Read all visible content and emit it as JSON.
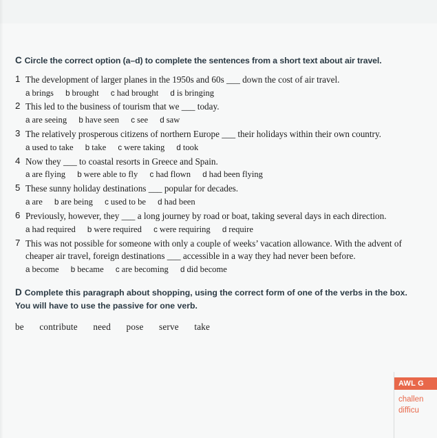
{
  "exercise_c": {
    "letter": "C",
    "instruction": "Circle the correct option (a–d) to complete the sentences from a short text about air travel.",
    "questions": [
      {
        "num": "1",
        "text": "The development of larger planes in the 1950s and 60s ___ down the cost of air travel.",
        "options": [
          {
            "letter": "a",
            "label": "brings"
          },
          {
            "letter": "b",
            "label": "brought"
          },
          {
            "letter": "c",
            "label": "had brought"
          },
          {
            "letter": "d",
            "label": "is bringing"
          }
        ]
      },
      {
        "num": "2",
        "text": "This led to the business of tourism that we ___ today.",
        "options": [
          {
            "letter": "a",
            "label": "are seeing"
          },
          {
            "letter": "b",
            "label": "have seen"
          },
          {
            "letter": "c",
            "label": "see"
          },
          {
            "letter": "d",
            "label": "saw"
          }
        ]
      },
      {
        "num": "3",
        "text": "The relatively prosperous citizens of northern Europe ___ their holidays within their own country.",
        "options": [
          {
            "letter": "a",
            "label": "used to take"
          },
          {
            "letter": "b",
            "label": "take"
          },
          {
            "letter": "c",
            "label": "were taking"
          },
          {
            "letter": "d",
            "label": "took"
          }
        ]
      },
      {
        "num": "4",
        "text": "Now they ___ to coastal resorts in Greece and Spain.",
        "options": [
          {
            "letter": "a",
            "label": "are flying"
          },
          {
            "letter": "b",
            "label": "were able to fly"
          },
          {
            "letter": "c",
            "label": "had flown"
          },
          {
            "letter": "d",
            "label": "had been flying"
          }
        ]
      },
      {
        "num": "5",
        "text": "These sunny holiday destinations ___ popular for decades.",
        "options": [
          {
            "letter": "a",
            "label": "are"
          },
          {
            "letter": "b",
            "label": "are being"
          },
          {
            "letter": "c",
            "label": "used to be"
          },
          {
            "letter": "d",
            "label": "had been"
          }
        ]
      },
      {
        "num": "6",
        "text": "Previously, however, they ___ a long journey by road or boat, taking several days in each direction.",
        "options": [
          {
            "letter": "a",
            "label": "had required"
          },
          {
            "letter": "b",
            "label": "were required"
          },
          {
            "letter": "c",
            "label": "were requiring"
          },
          {
            "letter": "d",
            "label": "require"
          }
        ]
      },
      {
        "num": "7",
        "text": "This was not possible for someone with only a couple of weeks’ vacation allowance. With the advent of cheaper air travel, foreign destinations ___ accessible in a way they had never been before.",
        "options": [
          {
            "letter": "a",
            "label": "become"
          },
          {
            "letter": "b",
            "label": "became"
          },
          {
            "letter": "c",
            "label": "are becoming"
          },
          {
            "letter": "d",
            "label": "did become"
          }
        ]
      }
    ]
  },
  "exercise_d": {
    "letter": "D",
    "instruction": "Complete this paragraph about shopping, using the correct form of one of the verbs in the box. You will have to use the passive for one verb.",
    "word_box": [
      "be",
      "contribute",
      "need",
      "pose",
      "serve",
      "take"
    ]
  },
  "side_panel": {
    "tag": "AWL G",
    "word1": "challen",
    "word2": "difficu",
    "accent_color": "#e8684a"
  }
}
